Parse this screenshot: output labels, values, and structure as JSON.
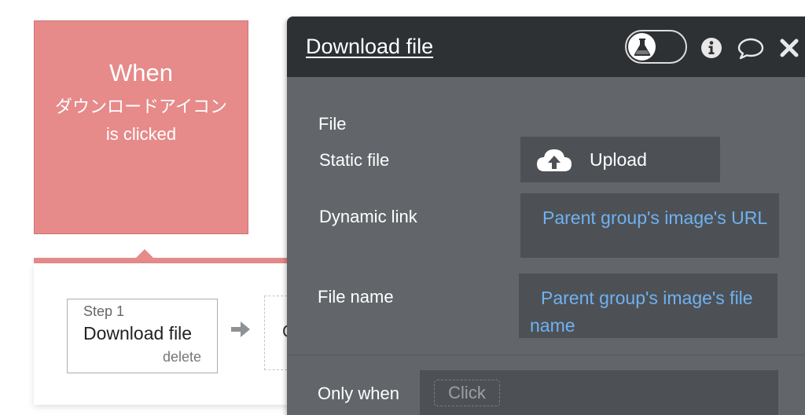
{
  "event": {
    "heading": "When",
    "element_name": "ダウンロードアイコン",
    "trigger": "is clicked"
  },
  "steps": [
    {
      "number_label": "Step 1",
      "title": "Download file",
      "delete_label": "delete"
    }
  ],
  "next_step": {
    "partial_label": "C"
  },
  "editor": {
    "title": "Download file",
    "icons": [
      "debug-flask-icon",
      "info-icon",
      "comment-icon",
      "close-icon"
    ],
    "file_section_label": "File",
    "static_file_label": "Static file",
    "upload_label": "Upload",
    "upload_icon": "cloud-upload-icon",
    "dynamic_link_label": "Dynamic link",
    "dynamic_link_value": "Parent group's image's URL",
    "file_name_label": "File name",
    "file_name_value": "Parent group's image's file name",
    "only_when_label": "Only when",
    "only_when_placeholder": "Click"
  },
  "colors": {
    "event_background": "#e68a8a",
    "editor_header": "#2d3134",
    "editor_body": "#62666a",
    "field_background": "#4d5155",
    "dynamic_text": "#6fb1f2"
  }
}
